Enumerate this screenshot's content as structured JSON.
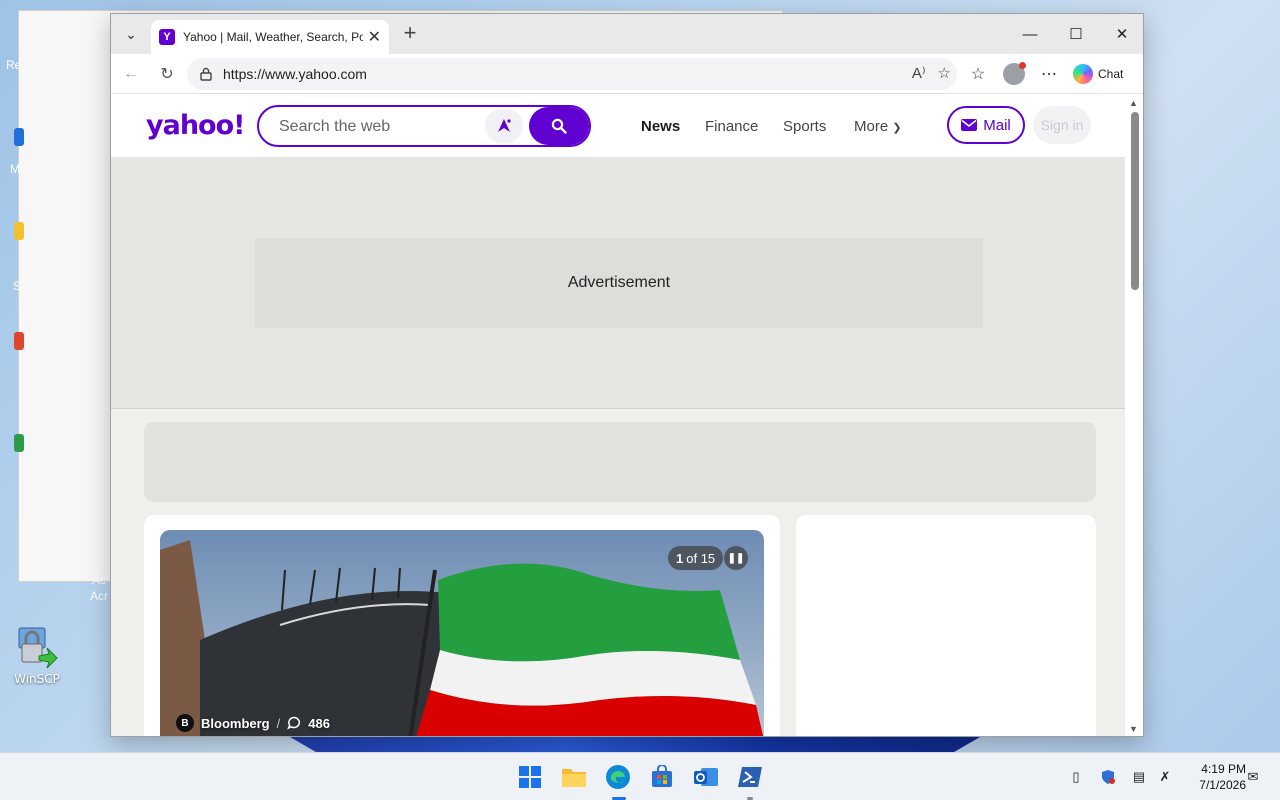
{
  "desktop": {
    "icons": [
      {
        "label": "WinSCP",
        "icon": "winscp-icon"
      }
    ],
    "partial_labels": [
      "Re",
      "M",
      "S",
      "Ac",
      "Acr"
    ]
  },
  "browser": {
    "tab": {
      "title": "Yahoo | Mail, Weather, Search, Politics, News, Finance, Sports & Videos",
      "favicon": "Y"
    },
    "address": {
      "url": "https://www.yahoo.com"
    },
    "toolbar": {
      "chat_label": "Chat"
    }
  },
  "yahoo": {
    "logo": "yahoo!",
    "search": {
      "placeholder": "Search the web",
      "value": ""
    },
    "nav": [
      {
        "label": "News",
        "active": true
      },
      {
        "label": "Finance",
        "active": false
      },
      {
        "label": "Sports",
        "active": false
      },
      {
        "label": "More",
        "active": false
      }
    ],
    "mail_label": "Mail",
    "signin_label": "Sign in",
    "ad_label": "Advertisement",
    "hero": {
      "counter_current": "1",
      "counter_text": "of 15",
      "source_badge": "B",
      "source": "Bloomberg",
      "comments": "486"
    },
    "colors": {
      "brand": "#6001d2"
    }
  },
  "taskbar": {
    "time": "4:19 PM",
    "date": "7/1/2026",
    "apps": [
      "start-icon",
      "file-explorer-icon",
      "edge-icon",
      "store-icon",
      "outlook-icon",
      "powershell-icon"
    ]
  }
}
